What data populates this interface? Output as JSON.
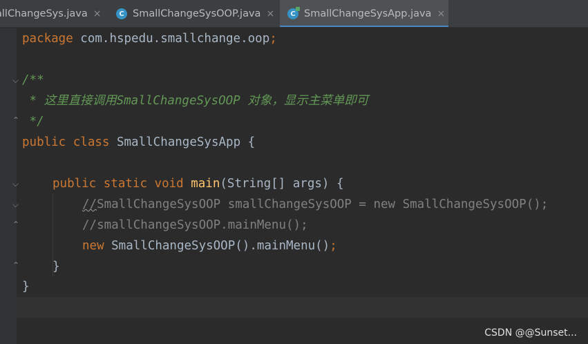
{
  "tabs": [
    {
      "label": "allChangeSys.java",
      "close": "×",
      "active": false
    },
    {
      "label": "SmallChangeSysOOP.java",
      "close": "×",
      "active": false,
      "icon_letter": "C"
    },
    {
      "label": "SmallChangeSysApp.java",
      "close": "×",
      "active": true,
      "icon_letter": "C"
    }
  ],
  "code": {
    "l1": {
      "kw": "package",
      "rest": " com.hspedu.smallchange.oop",
      "semi": ";"
    },
    "l3": {
      "doc": "/**"
    },
    "l4": {
      "doc": " * 这里直接调用SmallChangeSysOOP 对象，显示主菜单即可"
    },
    "l5": {
      "doc": " */"
    },
    "l6": {
      "kw1": "public",
      "kw2": "class",
      "rest": " SmallChangeSysApp {"
    },
    "l8": {
      "kw1": "public",
      "kw2": "static",
      "kw3": "void",
      "fn": "main",
      "rest": "(String[] args) {"
    },
    "l9": {
      "slashes": "//",
      "rest": "SmallChangeSysOOP smallChangeSysOOP = new SmallChangeSysOOP();"
    },
    "l10": {
      "text": "//smallChangeSysOOP.mainMenu();"
    },
    "l11": {
      "kw": "new",
      "rest": " SmallChangeSysOOP().mainMenu()",
      "semi": ";"
    },
    "l12": {
      "text": "}"
    },
    "l13": {
      "text": "}"
    }
  },
  "watermark": "CSDN @@Sunset...",
  "colors": {
    "keyword": "#cc7832",
    "text": "#a9b7c6",
    "doc_comment": "#629755",
    "line_comment": "#808080",
    "method": "#ffc66d",
    "tab_underline": "#4a88c7"
  }
}
